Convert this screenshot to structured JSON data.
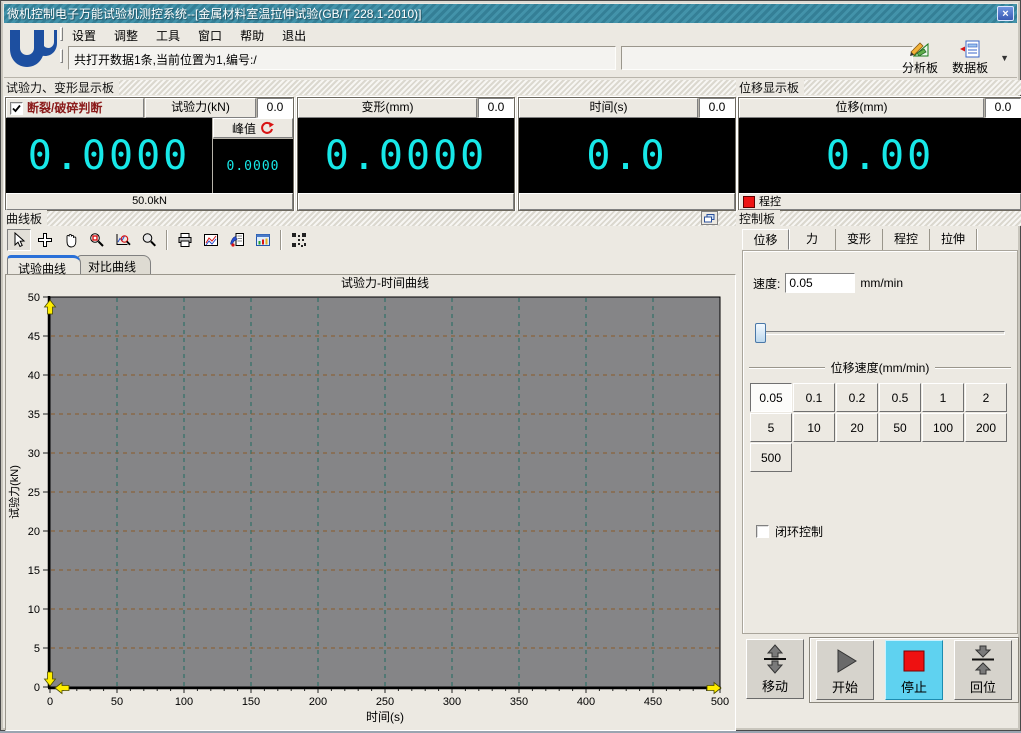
{
  "window": {
    "title": "微机控制电子万能试验机测控系统--[金属材料室温拉伸试验(GB/T 228.1-2010)]"
  },
  "menu": {
    "items": [
      "设置",
      "调整",
      "工具",
      "窗口",
      "帮助",
      "退出"
    ]
  },
  "toolbar": {
    "status_text": "共打开数据1条,当前位置为1,编号:/",
    "analysis_label": "分析板",
    "databoard_label": "数据板"
  },
  "display_section": {
    "title": "试验力、变形显示板",
    "force": {
      "break_label": "断裂/破碎判断",
      "break_checked": true,
      "title": "试验力(kN)",
      "rate": "0.0",
      "value": "0.0000",
      "peak_label": "峰值",
      "peak_value": "0.0000",
      "range": "50.0kN"
    },
    "deform": {
      "title": "变形(mm)",
      "rate": "0.0",
      "value": "0.0000"
    },
    "time": {
      "title": "时间(s)",
      "rate": "0.0",
      "value": "0.0"
    }
  },
  "displacement_section": {
    "title": "位移显示板",
    "panel": {
      "title": "位移(mm)",
      "rate": "0.0",
      "value": "0.00",
      "mode_label": "程控"
    }
  },
  "curve_section": {
    "title": "曲线板",
    "tabs": [
      "试验曲线",
      "对比曲线"
    ],
    "active_tab": 0
  },
  "chart_data": {
    "type": "line",
    "title": "试验力-时间曲线",
    "xlabel": "时间(s)",
    "ylabel": "试验力(kN)",
    "xlim": [
      0,
      500
    ],
    "ylim": [
      0,
      50
    ],
    "xtick_step": 50,
    "ytick_step": 5,
    "x_minor_step": 10,
    "grid": true,
    "plot_bg": "#858587",
    "hgrid_color": "#8a5a2a",
    "vgrid_color": "#1f6b60",
    "series": [
      {
        "name": "试验力-时间",
        "x": [],
        "y": []
      }
    ]
  },
  "control_section": {
    "title": "控制板",
    "tabs": [
      "位移",
      "力",
      "变形",
      "程控",
      "拉伸"
    ],
    "active_tab": 0,
    "speed_label": "速度:",
    "speed_value": "0.05",
    "speed_unit": "mm/min",
    "group_label": "位移速度(mm/min)",
    "speed_buttons": [
      "0.05",
      "0.1",
      "0.2",
      "0.5",
      "1",
      "2",
      "5",
      "10",
      "20",
      "50",
      "100",
      "200",
      "500"
    ],
    "selected_speed": "0.05",
    "closed_loop_label": "闭环控制",
    "closed_loop_checked": false,
    "buttons": {
      "move": "移动",
      "start": "开始",
      "stop": "停止",
      "reset": "回位"
    }
  },
  "colors": {
    "titlebar": "#3b8ba2",
    "display_text": "#17e8e8",
    "stop_button_bg": "#5fd2f0",
    "break_text": "#8b1a1a",
    "led_red": "#ee1414",
    "axis_marker_yellow": "#ffee00"
  }
}
